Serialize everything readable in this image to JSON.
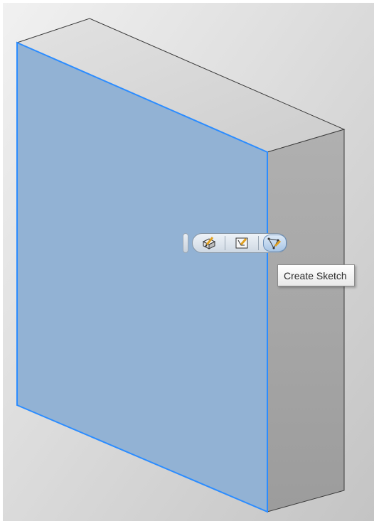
{
  "viewport": {
    "background_top": "#efefef",
    "background_bottom": "#c9c9c9"
  },
  "model": {
    "front_face_color": "#92b2d4",
    "top_face_color": "#d6d6d6",
    "side_face_color": "#a3a3a3",
    "highlight_edge_color": "#2b8cff",
    "edge_color": "#3a3a3a"
  },
  "mini_toolbar": {
    "buttons": [
      {
        "name": "edit-extrude-icon"
      },
      {
        "name": "edit-sketch-icon"
      },
      {
        "name": "create-sketch-icon",
        "active": true
      }
    ]
  },
  "tooltip": {
    "text": "Create Sketch"
  }
}
